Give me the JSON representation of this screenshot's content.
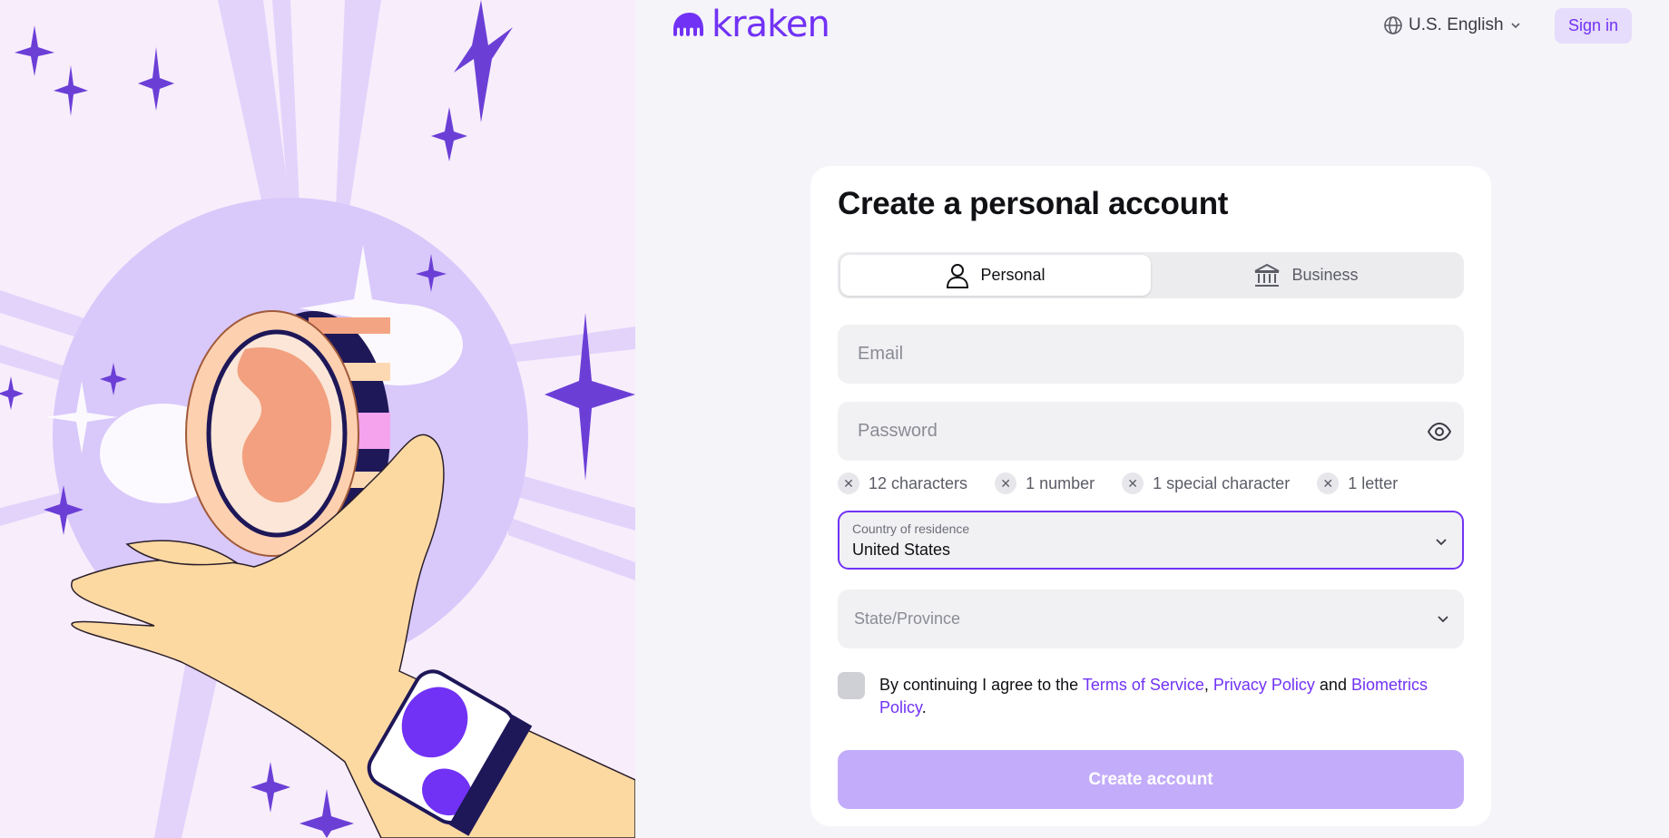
{
  "brand": {
    "name": "kraken",
    "accent": "#7132f5"
  },
  "header": {
    "language": "U.S. English",
    "signin_label": "Sign in"
  },
  "form": {
    "title": "Create a personal account",
    "account_types": [
      {
        "label": "Personal",
        "icon": "person-icon",
        "selected": true
      },
      {
        "label": "Business",
        "icon": "bank-icon",
        "selected": false
      }
    ],
    "email_placeholder": "Email",
    "password_placeholder": "Password",
    "password_requirements": [
      "12 characters",
      "1 number",
      "1 special character",
      "1 letter"
    ],
    "country_label": "Country of residence",
    "country_value": "United States",
    "state_placeholder": "State/Province",
    "agree": {
      "prefix": "By continuing I agree to the ",
      "terms": "Terms of Service",
      "sep": ", ",
      "privacy": "Privacy Policy",
      "and": " and ",
      "biometrics": "Biometrics Policy",
      "suffix": "."
    },
    "create_label": "Create account"
  }
}
